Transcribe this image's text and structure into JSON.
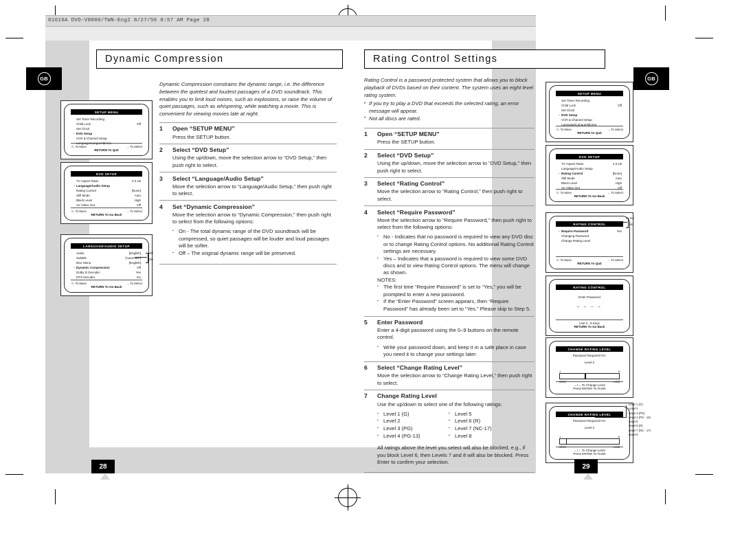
{
  "scan_header": "01616A DVD-V8000/TWN-Eng2  8/27/56 8:57 AM  Page 28",
  "region_tag": "GB",
  "left_page": {
    "page_number": "28",
    "title": "Dynamic Compression",
    "intro": "Dynamic Compression constrains the dynamic range, i.e. the difference between the quietest and loudest passages of a DVD soundtrack. This enables you to limit loud noises, such as explosions, or raise the volume of quiet passages, such as whispering, while watching a movie. This is convenient for viewing movies late at night.",
    "steps": [
      {
        "num": "1",
        "title": "Open “SETUP MENU”",
        "body": "Press the SETUP button.",
        "bullets": []
      },
      {
        "num": "2",
        "title": "Select “DVD Setup”",
        "body": "Using the up/down, move the selection arrow to “DVD Setup,” then push right to select.",
        "bullets": []
      },
      {
        "num": "3",
        "title": "Select “Language/Audio Setup”",
        "body": "Move the selection arrow to “Language/Audio Setup,” then push right to select.",
        "bullets": []
      },
      {
        "num": "4",
        "title": "Set “Dynamic Compression”",
        "body": "Move the selection arrow to “Dynamic Compression,” then push right to select from the following options:",
        "bullets": [
          "On - The total dynamic range of the DVD soundtrack will be compressed, so quiet passages will be louder and loud passages will be softer.",
          "Off – The original dynamic range will be preserved."
        ]
      }
    ],
    "screens": [
      {
        "title": "SETUP MENU",
        "rows": [
          {
            "arrow": "",
            "label": "Set Timer Recording",
            "value": ""
          },
          {
            "arrow": "",
            "label": "Child Lock",
            "value": "Off"
          },
          {
            "arrow": "",
            "label": "Set Clock",
            "value": ""
          },
          {
            "arrow": "→",
            "label": "DVD Setup",
            "value": ""
          },
          {
            "arrow": "",
            "label": "VCR & Channel Setup",
            "value": ""
          },
          {
            "arrow": "",
            "label": "Language/Langue/Idioma",
            "value": ""
          }
        ],
        "nav_left": "↑/↓ To  Move",
        "nav_right": "→ To Select",
        "footer": "RETURN To Quit"
      },
      {
        "title": "DVD SETUP",
        "rows": [
          {
            "arrow": "",
            "label": "TV Aspect Ratio",
            "value": "4:3 LB"
          },
          {
            "arrow": "→",
            "label": "Language/Audio Setup",
            "value": ""
          },
          {
            "arrow": "",
            "label": "Rating Control",
            "value": "[None]"
          },
          {
            "arrow": "",
            "label": "Still Mode",
            "value": "Auto"
          },
          {
            "arrow": "",
            "label": "Black Level",
            "value": "High"
          },
          {
            "arrow": "",
            "label": "AV Video Out",
            "value": "Off"
          }
        ],
        "nav_left": "↑/↓ To  Move",
        "nav_right": "→ To Select",
        "footer": "RETURN To Go Back"
      },
      {
        "title": "LANGUAGE/AUDIO SETUP",
        "rows": [
          {
            "arrow": "",
            "label": "Audio",
            "value": "[English]"
          },
          {
            "arrow": "",
            "label": "Subtitle",
            "value": "[Automatic]"
          },
          {
            "arrow": "",
            "label": "Disc Menu",
            "value": "[English]"
          },
          {
            "arrow": "→",
            "label": "Dynamic Compression",
            "value": "Off"
          },
          {
            "arrow": "",
            "label": "Dolby D Decoder",
            "value": "Yes"
          },
          {
            "arrow": "",
            "label": "DTS Decoder",
            "value": "No"
          }
        ],
        "nav_left": "↑/↓ To  Move",
        "nav_right": "→ To Select",
        "footer": "RETURN To Go Back",
        "callout": [
          "Off",
          "On"
        ]
      }
    ]
  },
  "right_page": {
    "page_number": "29",
    "title": "Rating Control Settings",
    "intro": "Rating Control is a password protected system that allows you to block playback of DVDs based on their content. The system uses an eight level rating system.",
    "intro_bullets": [
      "If you try to play a DVD that exceeds the selected rating, an error message will appear.",
      "Not all discs are rated."
    ],
    "steps": [
      {
        "num": "1",
        "title": "Open “SETUP MENU”",
        "body": "Press the SETUP button.",
        "bullets": []
      },
      {
        "num": "2",
        "title": "Select “DVD Setup”",
        "body": "Using the up/down, move the selection arrow to “DVD Setup,” then push right to select.",
        "bullets": []
      },
      {
        "num": "3",
        "title": "Select “Rating Control”",
        "body": "Move the selection arrow to “Rating Control,” then push right to select.",
        "bullets": []
      },
      {
        "num": "4",
        "title": "Select “Require Password”",
        "body": "Move the selection arrow to “Require Password,” then push right to select from the following options:",
        "bullets": [
          "No - Indicates that no password is required to view any DVD disc or to change Rating Control options. No additional Rating Control settings are necessary.",
          "Yes – Indicates that a password is required to view some DVD discs and to view Rating Control options. The menu will change as shown."
        ],
        "notes_label": "NOTES:",
        "notes": [
          "The first time “Require Password” is set to “Yes,” you will be prompted to enter a new password.",
          "If the “Enter Password” screen appears, then “Require Password” has already been set to “Yes.” Please skip to Step 5."
        ]
      },
      {
        "num": "5",
        "title": "Enter Password",
        "body": "Enter a 4-digit password using the 0–9 buttons on the remote control.",
        "bullets": [
          "Write your password down, and keep it in a safe place in case you need it to change your settings later."
        ]
      },
      {
        "num": "6",
        "title": "Select “Change Rating Level”",
        "body": "Move the selection arrow to “Change Rating Level,” then push right to select.",
        "bullets": []
      },
      {
        "num": "7",
        "title": "Change Rating Level",
        "body": "Use the up/down to select one of the following ratings:",
        "bullets": []
      }
    ],
    "ratings_left": [
      "Level 1 (G)",
      "Level 2",
      "Level 3 (PG)",
      "Level 4 (PG-13)"
    ],
    "ratings_right": [
      "Level 5",
      "Level 6 (R)",
      "Level 7 (NC-17)",
      "Level 8"
    ],
    "closing": "All ratings above the level you select will also be blocked, e.g., if you block Level 6, then Levels 7 and 8 will also be blocked. Press Enter to confirm your selection.",
    "screens": [
      {
        "title": "SETUP MENU",
        "rows": [
          {
            "arrow": "",
            "label": "Set Timer Recording",
            "value": ""
          },
          {
            "arrow": "",
            "label": "Child Lock",
            "value": "Off"
          },
          {
            "arrow": "",
            "label": "Set Clock",
            "value": ""
          },
          {
            "arrow": "→",
            "label": "DVD Setup",
            "value": ""
          },
          {
            "arrow": "",
            "label": "VCR & Channel Setup",
            "value": ""
          },
          {
            "arrow": "",
            "label": "Language/Langue/Idioma",
            "value": ""
          }
        ],
        "nav_left": "↑/↓ To  Move",
        "nav_right": "→ To Select",
        "footer": "RETURN To Quit"
      },
      {
        "title": "DVD SETUP",
        "rows": [
          {
            "arrow": "",
            "label": "TV Aspect Ratio",
            "value": "4:3 LB"
          },
          {
            "arrow": "",
            "label": "Language/Audio Setup",
            "value": ""
          },
          {
            "arrow": "→",
            "label": "Rating Control",
            "value": "[None]"
          },
          {
            "arrow": "",
            "label": "Still Mode",
            "value": "Auto"
          },
          {
            "arrow": "",
            "label": "Black Level",
            "value": "High"
          },
          {
            "arrow": "",
            "label": "AV Video Out",
            "value": "Off"
          }
        ],
        "nav_left": "↑/↓ To  Move",
        "nav_right": "→ To Select",
        "footer": "RETURN To Go Back"
      },
      {
        "title": "RATING CONTROL",
        "rows": [
          {
            "arrow": "→",
            "label": "Require Password",
            "value": "Yes"
          },
          {
            "arrow": "",
            "label": "Changing Password",
            "value": ""
          },
          {
            "arrow": "",
            "label": "Change Rating Level",
            "value": ""
          }
        ],
        "nav_left": "↑/↓ To  Move",
        "nav_right": "→ To Select",
        "footer": "RETURN To Quit",
        "callout": [
          "Yes",
          "No"
        ]
      },
      {
        "title": "RATING CONTROL",
        "prompt": "Enter Password",
        "password_mask": "– – – –",
        "hint": "Use 0 - 9 Keys",
        "footer": "RETURN To Go Back"
      },
      {
        "title": "CHANGE RATING LEVEL",
        "prompt": "Password Required For:",
        "level_label": "Level 2",
        "scale_min": "1",
        "scale_max": "8",
        "cap_left": "Child",
        "cap_right": "Adult",
        "nav": "←/→ To Change Level",
        "footer": "Press ENTER To Finish"
      },
      {
        "title": "CHANGE RATING LEVEL",
        "prompt": "Password Required For:",
        "level_label": "Level 2",
        "scale_min": "1",
        "scale_max": "8",
        "cap_left": "Child",
        "cap_right": "Adult",
        "nav": "←/→ To Change Level",
        "footer": "Press ENTER To Finish",
        "legend": [
          "Level 1 (G)",
          "Level 2",
          "Level 3 (PG)",
          "Level 4 (PG - 13)",
          "Level 5",
          "Level 6 (R)",
          "Level 7 (NC - 17)",
          "Level 8"
        ]
      }
    ]
  }
}
